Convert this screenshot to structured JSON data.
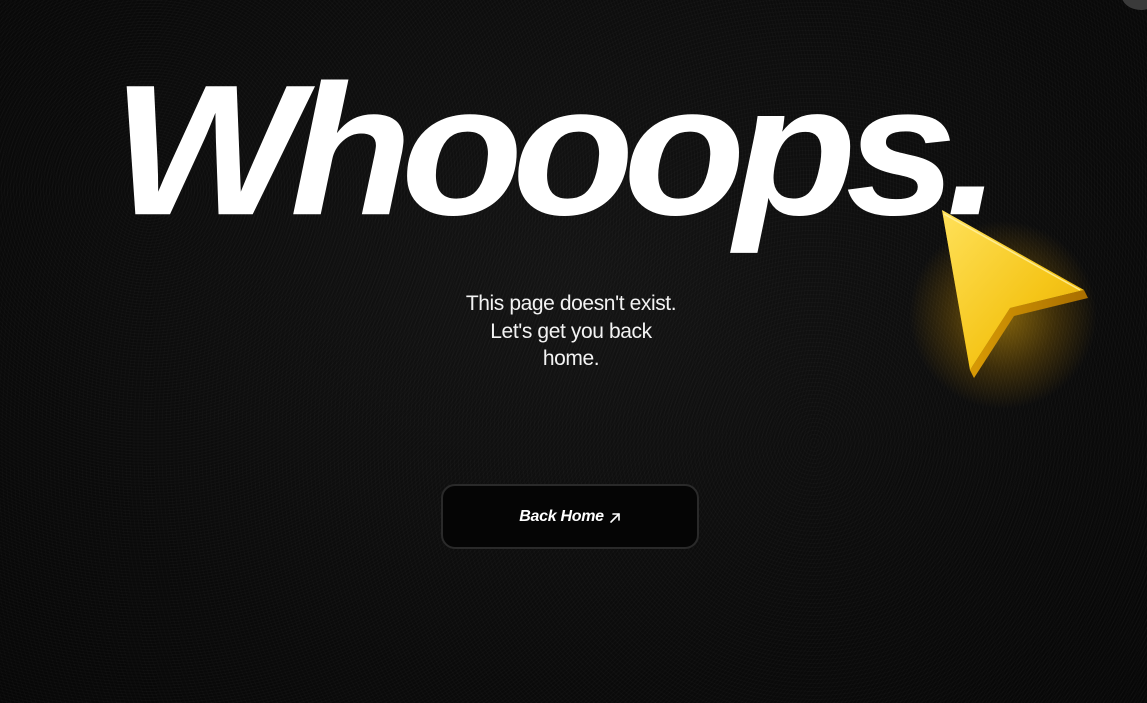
{
  "headline": "Whooops.",
  "message": {
    "line1": "This page doesn't exist.",
    "line2": "Let's get you back",
    "line3": "home."
  },
  "back_button": {
    "label": "Back Home",
    "icon": "arrow-up-right-icon"
  },
  "decor": {
    "cursor_icon": "cursor-pointer-icon",
    "accent_color": "#F5C518",
    "background_color": "#0B0B0B",
    "text_color": "#FFFFFF"
  }
}
